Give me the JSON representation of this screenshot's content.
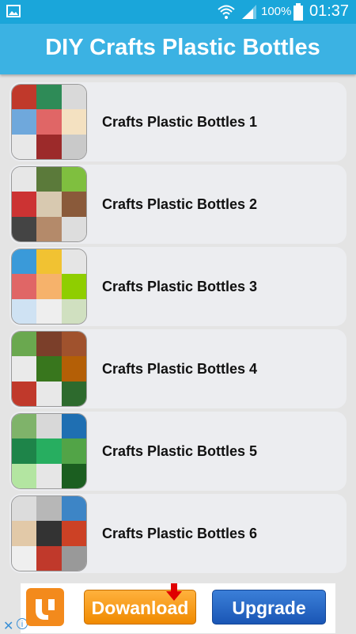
{
  "status_bar": {
    "battery_percent": "100%",
    "time": "01:37",
    "icons": [
      "gallery-icon",
      "wifi-icon",
      "signal-icon",
      "battery-icon"
    ]
  },
  "header": {
    "title": "DIY Crafts Plastic Bottles",
    "background": "#3bb2e3"
  },
  "list": {
    "items": [
      {
        "label": "Crafts Plastic Bottles 1"
      },
      {
        "label": "Crafts Plastic Bottles 2"
      },
      {
        "label": "Crafts Plastic Bottles 3"
      },
      {
        "label": "Crafts Plastic Bottles 4"
      },
      {
        "label": "Crafts Plastic Bottles 5"
      },
      {
        "label": "Crafts Plastic Bottles 6"
      }
    ]
  },
  "ad": {
    "download_label": "Dowanload",
    "upgrade_label": "Upgrade",
    "download_color": "#f39a1e",
    "upgrade_color": "#2a6cc9"
  }
}
